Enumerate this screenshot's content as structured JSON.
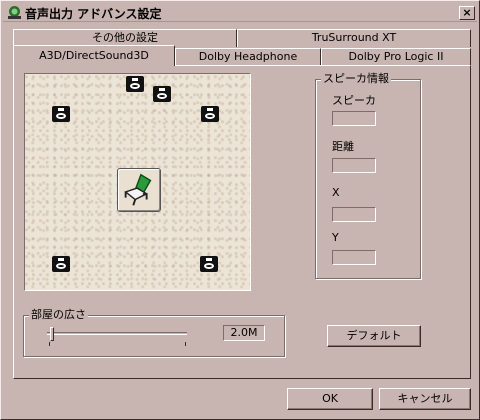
{
  "window": {
    "title": "音声出力 アドバンス設定",
    "close_label": "×"
  },
  "tabs": {
    "back_row": [
      {
        "label": "その他の設定"
      },
      {
        "label": "TruSurround XT"
      }
    ],
    "front_row": [
      {
        "label": "A3D/DirectSound3D",
        "active": true
      },
      {
        "label": "Dolby Headphone"
      },
      {
        "label": "Dolby Pro Logic II"
      }
    ]
  },
  "speaker_info": {
    "group_label": "スピーカ情報",
    "speaker_label": "スピーカ",
    "distance_label": "距離",
    "x_label": "X",
    "y_label": "Y",
    "speaker_value": "",
    "distance_value": "",
    "x_value": "",
    "y_value": ""
  },
  "room_size": {
    "group_label": "部屋の広さ",
    "value": "2.0M",
    "slider_position": 0.02
  },
  "buttons": {
    "default_label": "デフォルト",
    "ok_label": "OK",
    "cancel_label": "キャンセル"
  },
  "room": {
    "speakers": [
      "front-left",
      "center",
      "sub",
      "front-right",
      "rear-left",
      "rear-right"
    ],
    "listener_icon": "chair-icon",
    "accent_color": "#2a9a3a"
  }
}
